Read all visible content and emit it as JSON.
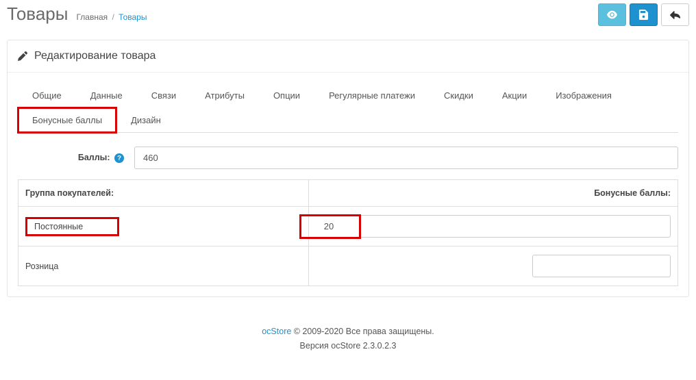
{
  "header": {
    "title": "Товары",
    "breadcrumb_home": "Главная",
    "breadcrumb_current": "Товары"
  },
  "panel": {
    "title": "Редактирование товара"
  },
  "tabs": [
    {
      "label": "Общие"
    },
    {
      "label": "Данные"
    },
    {
      "label": "Связи"
    },
    {
      "label": "Атрибуты"
    },
    {
      "label": "Опции"
    },
    {
      "label": "Регулярные платежи"
    },
    {
      "label": "Скидки"
    },
    {
      "label": "Акции"
    },
    {
      "label": "Изображения"
    },
    {
      "label": "Бонусные баллы",
      "active": true
    },
    {
      "label": "Дизайн"
    }
  ],
  "form": {
    "points_label": "Баллы:",
    "points_value": "460"
  },
  "table": {
    "header_group": "Группа покупателей:",
    "header_points": "Бонусные баллы:",
    "rows": [
      {
        "group": "Постоянные",
        "points": "20",
        "highlighted": true
      },
      {
        "group": "Розница",
        "points": ""
      }
    ]
  },
  "footer": {
    "brand": "ocStore",
    "copyright": " © 2009-2020 Все права защищены.",
    "version": "Версия ocStore 2.3.0.2.3"
  }
}
